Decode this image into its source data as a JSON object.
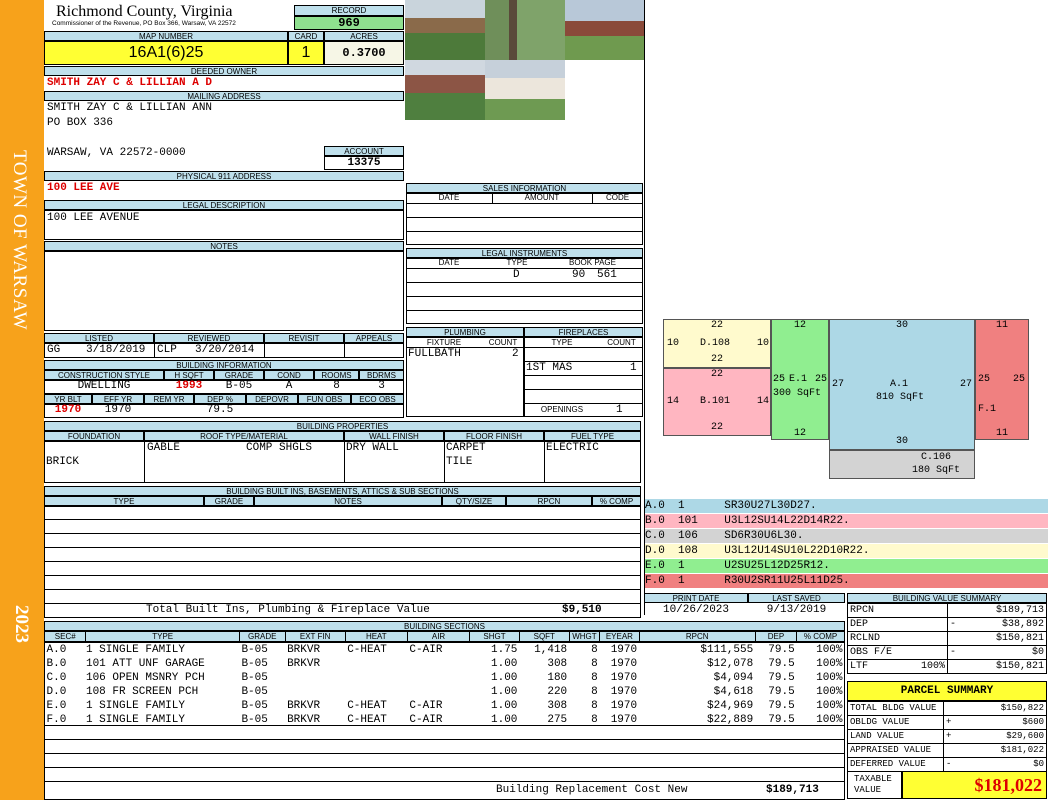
{
  "sidebar": {
    "town": "TOWN OF WARSAW",
    "year": "2023"
  },
  "header": {
    "county": "Richmond County, Virginia",
    "commissioner": "Commissioner of the Revenue, PO Box 366, Warsaw, VA 22572",
    "record_label": "RECORD",
    "record": "969",
    "map_number_label": "MAP NUMBER",
    "map_number": "16A1(6)25",
    "card_label": "CARD",
    "card": "1",
    "acres_label": "ACRES",
    "acres": "0.3700"
  },
  "owner": {
    "deeded_owner_label": "DEEDED OWNER",
    "deeded_owner": "SMITH ZAY C & LILLIAN A D",
    "mailing_label": "MAILING ADDRESS",
    "mailing_line1": "SMITH ZAY C & LILLIAN ANN",
    "mailing_line2": "PO BOX 336",
    "mailing_line3": "WARSAW, VA 22572-0000",
    "account_label": "ACCOUNT",
    "account": "13375",
    "physical_label": "PHYSICAL 911 ADDRESS",
    "physical": "100 LEE AVE",
    "legal_label": "LEGAL DESCRIPTION",
    "legal": "100 LEE AVENUE",
    "notes_label": "NOTES"
  },
  "review": {
    "listed_label": "LISTED",
    "reviewed_label": "REVIEWED",
    "revisit_label": "REVISIT",
    "appeals_label": "APPEALS",
    "listed_by": "GG",
    "listed_date": "3/18/2019",
    "reviewed_by": "CLP",
    "reviewed_date": "3/20/2014"
  },
  "building_info": {
    "title": "BUILDING INFORMATION",
    "construction_label": "CONSTRUCTION STYLE",
    "hsqft_label": "H SQFT",
    "grade_label": "GRADE",
    "cond_label": "COND",
    "rooms_label": "ROOMS",
    "bdrms_label": "BDRMS",
    "construction": "DWELLING",
    "hsqft": "1993",
    "grade": "B-05",
    "cond": "A",
    "rooms": "8",
    "bdrms": "3",
    "yrblt_label": "YR BLT",
    "effyr_label": "EFF YR",
    "remyr_label": "REM YR",
    "dep_label": "DEP %",
    "depovr_label": "DEPOVR",
    "funobs_label": "FUN OBS",
    "ecoobs_label": "ECO OBS",
    "yrblt": "1970",
    "effyr": "1970",
    "dep": "79.5"
  },
  "building_props": {
    "title": "BUILDING PROPERTIES",
    "foundation_label": "FOUNDATION",
    "roof_label": "ROOF TYPE/MATERIAL",
    "wall_label": "WALL FINISH",
    "floor_label": "FLOOR FINISH",
    "fuel_label": "FUEL TYPE",
    "foundation": "BRICK",
    "roof_type": "GABLE",
    "roof_material": "COMP SHGLS",
    "wall": "DRY WALL",
    "floor1": "CARPET",
    "floor2": "TILE",
    "fuel": "ELECTRIC"
  },
  "builtins": {
    "title": "BUILDING BUILT INS, BASEMENTS, ATTICS & SUB SECTIONS",
    "cols": [
      "TYPE",
      "GRADE",
      "NOTES",
      "QTY/SIZE",
      "RPCN",
      "% COMP"
    ],
    "total_label": "Total Built Ins, Plumbing & Fireplace Value",
    "total": "$9,510"
  },
  "sales": {
    "title": "SALES INFORMATION",
    "cols": [
      "DATE",
      "AMOUNT",
      "CODE"
    ]
  },
  "legal_instr": {
    "title": "LEGAL INSTRUMENTS",
    "cols": [
      "DATE",
      "TYPE",
      "BOOK PAGE"
    ],
    "type": "D",
    "book": "90",
    "page": "561"
  },
  "plumbing": {
    "title": "PLUMBING",
    "fixture_label": "FIXTURE",
    "count_label": "COUNT",
    "fixture": "FULLBATH",
    "count": "2"
  },
  "fireplaces": {
    "title": "FIREPLACES",
    "type_label": "TYPE",
    "count_label": "COUNT",
    "type": "1ST MAS",
    "count": "1",
    "openings_label": "OPENINGS",
    "openings": "1"
  },
  "sketch": {
    "D": {
      "label": "D.108",
      "top": "22",
      "bottom": "22",
      "left": "10",
      "right": "10"
    },
    "B": {
      "label": "B.101",
      "top": "22",
      "bottom": "22",
      "left": "14",
      "right": "14"
    },
    "E": {
      "label": "E.1",
      "area": "300 SqFt",
      "top": "12",
      "bottom": "12",
      "left": "25",
      "right": "25"
    },
    "A": {
      "label": "A.1",
      "area": "810 SqFt",
      "top": "30",
      "bottom": "30",
      "left": "27",
      "right": "27"
    },
    "F": {
      "label": "F.1",
      "top": "11",
      "bottom": "11",
      "left": "25",
      "right": "25"
    },
    "C": {
      "label": "C.106",
      "area": "180 SqFt"
    }
  },
  "legend": [
    {
      "id": "A.0",
      "code": "1",
      "path": "SR30U27L30D27.",
      "color": "#add8e6"
    },
    {
      "id": "B.0",
      "code": "101",
      "path": "U3L12SU14L22D14R22.",
      "color": "#ffb6c1"
    },
    {
      "id": "C.0",
      "code": "106",
      "path": "SD6R30U6L30.",
      "color": "#d3d3d3"
    },
    {
      "id": "D.0",
      "code": "108",
      "path": "U3L12U14SU10L22D10R22.",
      "color": "#fffacd"
    },
    {
      "id": "E.0",
      "code": "1",
      "path": "U2SU25L12D25R12.",
      "color": "#90ee90"
    },
    {
      "id": "F.0",
      "code": "1",
      "path": "R30U2SR11U25L11D25.",
      "color": "#f08080"
    }
  ],
  "dates": {
    "print_label": "PRINT DATE",
    "print": "10/26/2023",
    "saved_label": "LAST SAVED",
    "saved": "9/13/2019"
  },
  "sections": {
    "title": "BUILDING SECTIONS",
    "cols": [
      "SEC#",
      "TYPE",
      "GRADE",
      "EXT FIN",
      "HEAT",
      "AIR",
      "SHGT",
      "SQFT",
      "WHGT",
      "EYEAR",
      "RPCN",
      "DEP",
      "% COMP"
    ],
    "rows": [
      [
        "A.0",
        "1 SINGLE FAMILY",
        "B-05",
        "BRKVR",
        "C-HEAT",
        "C-AIR",
        "1.75",
        "1,418",
        "8",
        "1970",
        "$111,555",
        "79.5",
        "100%"
      ],
      [
        "B.0",
        "101 ATT UNF GARAGE",
        "B-05",
        "BRKVR",
        "",
        "",
        "1.00",
        "308",
        "8",
        "1970",
        "$12,078",
        "79.5",
        "100%"
      ],
      [
        "C.0",
        "106 OPEN MSNRY PCH",
        "B-05",
        "",
        "",
        "",
        "1.00",
        "180",
        "8",
        "1970",
        "$4,094",
        "79.5",
        "100%"
      ],
      [
        "D.0",
        "108 FR SCREEN PCH",
        "B-05",
        "",
        "",
        "",
        "1.00",
        "220",
        "8",
        "1970",
        "$4,618",
        "79.5",
        "100%"
      ],
      [
        "E.0",
        "1 SINGLE FAMILY",
        "B-05",
        "BRKVR",
        "C-HEAT",
        "C-AIR",
        "1.00",
        "308",
        "8",
        "1970",
        "$24,969",
        "79.5",
        "100%"
      ],
      [
        "F.0",
        "1 SINGLE FAMILY",
        "B-05",
        "BRKVR",
        "C-HEAT",
        "C-AIR",
        "1.00",
        "275",
        "8",
        "1970",
        "$22,889",
        "79.5",
        "100%"
      ]
    ],
    "replacement_label": "Building Replacement Cost New",
    "replacement": "$189,713"
  },
  "bvs": {
    "title": "BUILDING VALUE SUMMARY",
    "rpcn_label": "RPCN",
    "rpcn": "$189,713",
    "dep_label": "DEP",
    "dep_sign": "-",
    "dep": "$38,892",
    "rclnd_label": "RCLND",
    "rclnd": "$150,821",
    "obs_label": "OBS F/E",
    "obs_sign": "-",
    "obs": "$0",
    "ltf_label": "LTF",
    "ltf_pct": "100%",
    "ltf": "$150,821"
  },
  "parcel": {
    "title": "PARCEL SUMMARY",
    "bldg_label": "TOTAL BLDG VALUE",
    "bldg": "$150,822",
    "obldg_label": "OBLDG VALUE",
    "obldg_sign": "+",
    "obldg": "$600",
    "land_label": "LAND VALUE",
    "land_sign": "+",
    "land": "$29,600",
    "appraised_label": "APPRAISED VALUE",
    "appraised": "$181,022",
    "deferred_label": "DEFERRED VALUE",
    "deferred_sign": "-",
    "deferred": "$0",
    "taxable_label1": "TAXABLE",
    "taxable_label2": "VALUE",
    "taxable": "$181,022"
  }
}
